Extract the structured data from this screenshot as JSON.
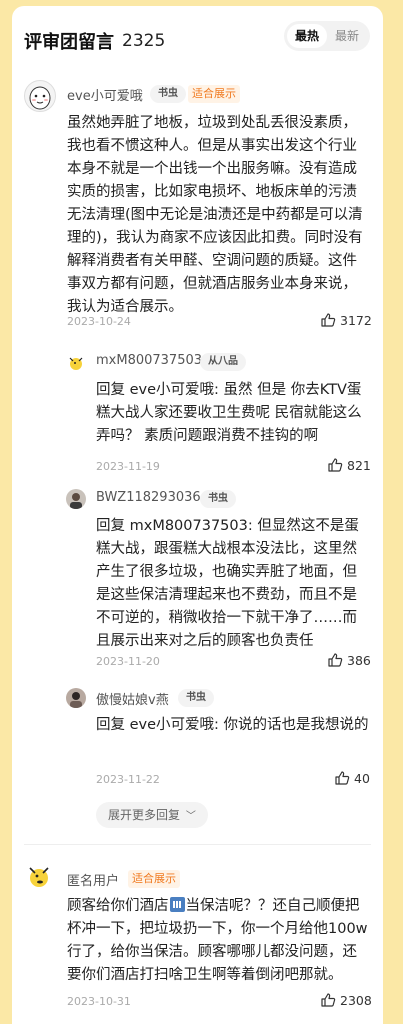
{
  "header": {
    "title": "评审团留言",
    "count": "2325"
  },
  "sort": {
    "hot": "最热",
    "new": "最新"
  },
  "comments": [
    {
      "username": "eve小可爱哦",
      "badge": "书虫",
      "tag": "适合展示",
      "text": "虽然她弄脏了地板，垃圾到处乱丢很没素质，我也看不惯这种人。但是从事实出发这个行业本身不就是一个出钱一个出服务嘛。没有造成实质的损害，比如家电损坏、地板床单的污渍无法清理(图中无论是油渍还是中药都是可以清理的)，我认为商家不应该因此扣费。同时没有解释消费者有关甲醛、空调问题的质疑。这件事双方都有问题，但就酒店服务业本身来说，我认为适合展示。",
      "date": "2023-10-24",
      "likes": "3172"
    },
    {
      "username": "匿名用户",
      "tag": "适合展示",
      "text_before": "顾客给你们酒店",
      "text_after": "当保洁呢？？还自己顺便把杯冲一下，把垃圾扔一下，你一个月给他100w行了，给你当保洁。顾客哪哪儿都没问题，还要你们酒店打扫啥卫生啊等着倒闭吧那就。",
      "date": "2023-10-31",
      "likes": "2308"
    }
  ],
  "replies": [
    {
      "username": "mxM800737503",
      "badge": "从八品",
      "text": "回复 eve小可爱哦: 虽然 但是 你去KTV蛋糕大战人家还要收卫生费呢 民宿就能这么弄吗？ 素质问题跟消费不挂钩的啊",
      "date": "2023-11-19",
      "likes": "821"
    },
    {
      "username": "BWZ118293036",
      "badge": "书虫",
      "text": "回复 mxM800737503: 但显然这不是蛋糕大战，跟蛋糕大战根本没法比，这里然产生了很多垃圾，也确实弄脏了地面，但是这些保洁清理起来也不费劲，而且不是不可逆的，稍微收拾一下就干净了……而且展示出来对之后的顾客也负责任",
      "date": "2023-11-20",
      "likes": "386"
    },
    {
      "username": "傲慢姑娘v燕",
      "badge": "书虫",
      "text": "回复 eve小可爱哦: 你说的话也是我想说的",
      "date": "2023-11-22",
      "likes": "40"
    }
  ],
  "more_replies": "展开更多回复",
  "colors": {
    "page_bg": "#fbe8a6",
    "tag_orange": "#f07a20"
  }
}
